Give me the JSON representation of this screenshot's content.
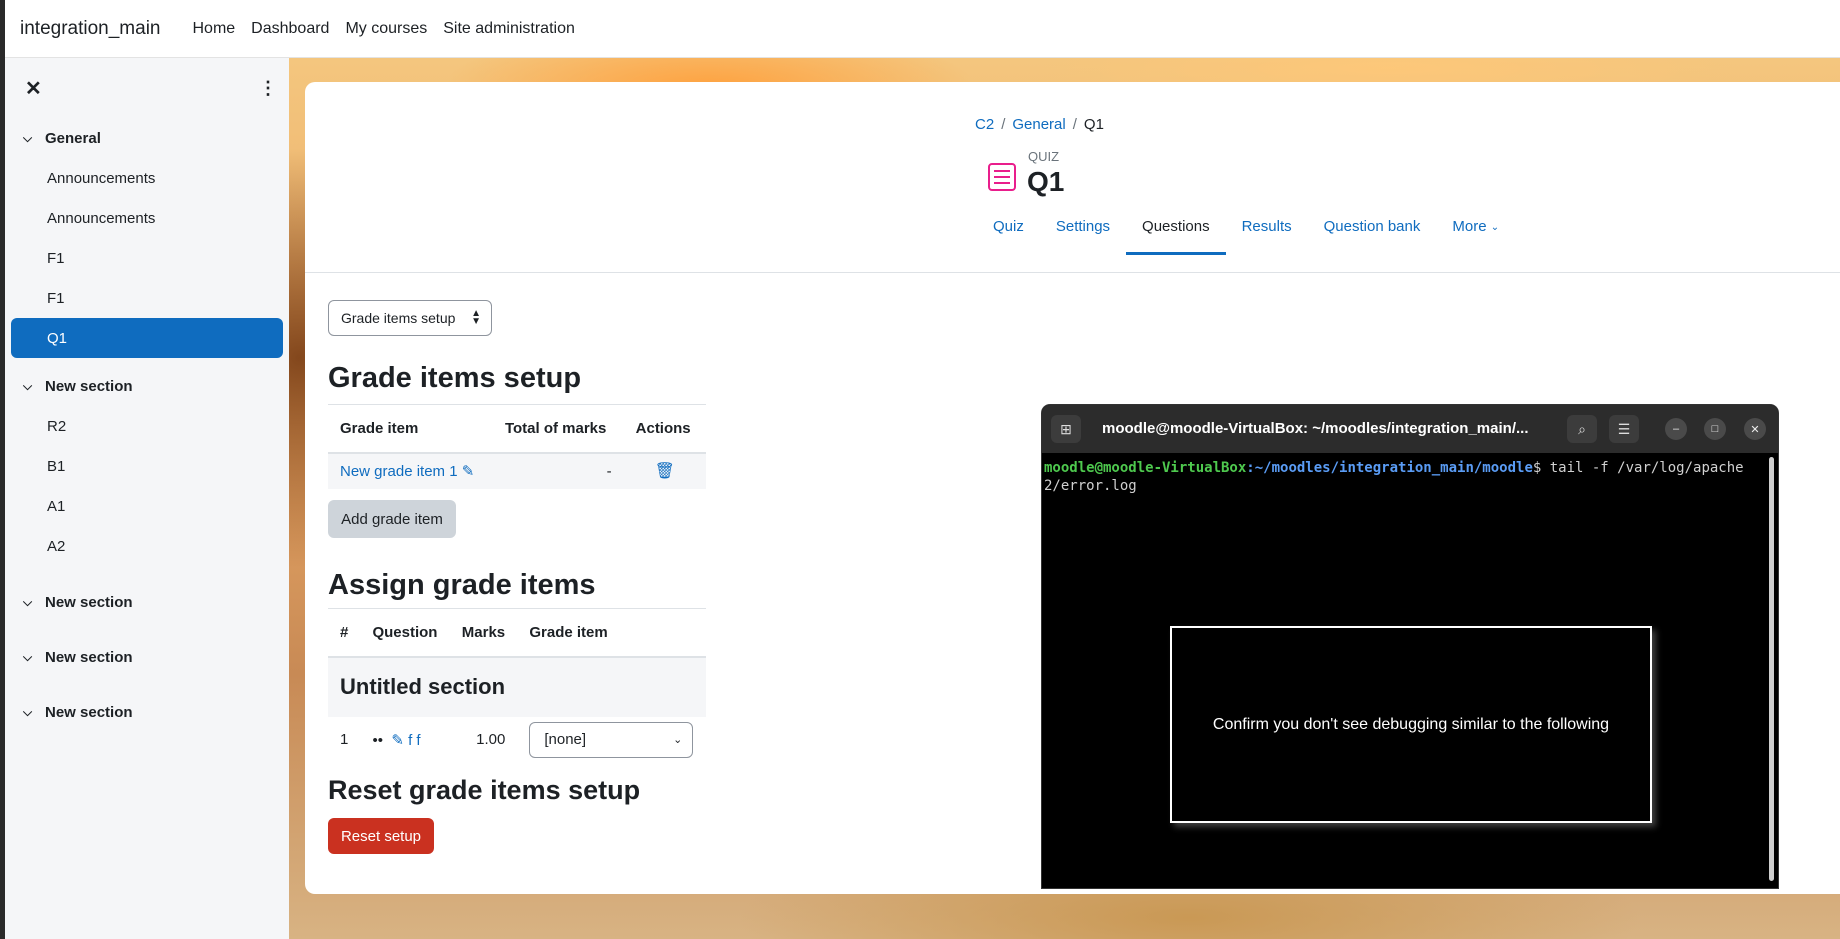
{
  "navbar": {
    "brand": "integration_main",
    "links": [
      "Home",
      "Dashboard",
      "My courses",
      "Site administration"
    ]
  },
  "sidebar": {
    "close_glyph": "✕",
    "menu_glyph": "⋮",
    "sections": [
      {
        "title": "General",
        "items": [
          "Announcements",
          "Announcements",
          "F1",
          "F1",
          "Q1"
        ]
      },
      {
        "title": "New section",
        "items": [
          "R2",
          "B1",
          "A1",
          "A2"
        ]
      },
      {
        "title": "New section",
        "items": []
      },
      {
        "title": "New section",
        "items": []
      },
      {
        "title": "New section",
        "items": []
      }
    ],
    "active_item": "Q1"
  },
  "breadcrumb": [
    "C2",
    "General",
    "Q1"
  ],
  "header": {
    "type": "QUIZ",
    "title": "Q1"
  },
  "tabs": [
    "Quiz",
    "Settings",
    "Questions",
    "Results",
    "Question bank",
    "More"
  ],
  "active_tab": "Questions",
  "setup_select": "Grade items setup",
  "grade_items": {
    "heading": "Grade items setup",
    "columns": [
      "Grade item",
      "Total of marks",
      "Actions"
    ],
    "rows": [
      {
        "name": "New grade item 1",
        "total": "-"
      }
    ],
    "add_button": "Add grade item"
  },
  "assign": {
    "heading": "Assign grade items",
    "columns": [
      "#",
      "Question",
      "Marks",
      "Grade item"
    ],
    "section_title": "Untitled section",
    "rows": [
      {
        "num": "1",
        "question": "f f",
        "marks": "1.00",
        "grade_item": "[none]"
      }
    ]
  },
  "reset": {
    "heading": "Reset grade items setup",
    "button": "Reset setup"
  },
  "terminal": {
    "title": "moodle@moodle-VirtualBox: ~/moodles/integration_main/...",
    "prompt_user": "moodle@moodle-VirtualBox",
    "prompt_path": ":~/moodles/integration_main/moodle",
    "command": "$ tail -f /var/log/apache2/error.log",
    "dialog_text": "Confirm you don't see debugging similar to the following"
  },
  "colors": {
    "brand_blue": "#0f6cbf",
    "danger": "#ca3120",
    "quiz_icon": "#e91e8c"
  }
}
